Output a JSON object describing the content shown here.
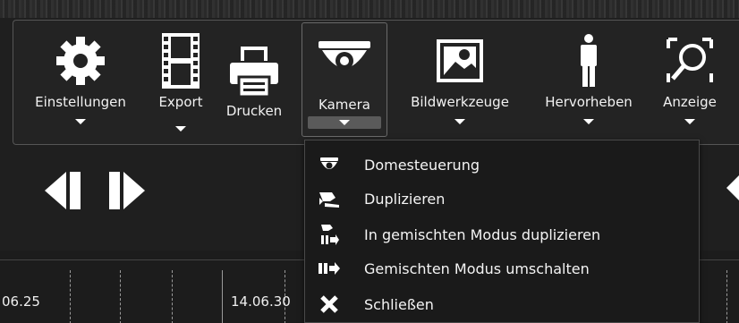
{
  "toolbar": {
    "tools": [
      {
        "label": "Einstellungen",
        "icon": "gear-icon",
        "has_dropdown": true
      },
      {
        "label": "Export",
        "icon": "film-strip-icon",
        "has_dropdown": true
      },
      {
        "label": "Drucken",
        "icon": "printer-icon",
        "has_dropdown": false
      },
      {
        "label": "Kamera",
        "icon": "dome-camera-icon",
        "has_dropdown": true,
        "active": true
      },
      {
        "label": "Bildwerkzeuge",
        "icon": "image-tools-icon",
        "has_dropdown": true
      },
      {
        "label": "Hervorheben",
        "icon": "person-icon",
        "has_dropdown": true
      },
      {
        "label": "Anzeige",
        "icon": "magnifier-icon",
        "has_dropdown": true
      }
    ]
  },
  "camera_menu": {
    "items": [
      {
        "label": "Domesteuerung",
        "icon": "dome-camera-icon"
      },
      {
        "label": "Duplizieren",
        "icon": "duplicate-camera-icon"
      },
      {
        "label": "In gemischten Modus duplizieren",
        "icon": "duplicate-mixed-mode-icon"
      },
      {
        "label": "Gemischten Modus umschalten",
        "icon": "mixed-mode-toggle-icon"
      },
      {
        "label": "Schließen",
        "icon": "close-icon"
      }
    ]
  },
  "timeline": {
    "labels": [
      "06.25",
      "14.06.30"
    ]
  },
  "colors": {
    "background": "#1f1f1f",
    "toolbar_bg": "#232323",
    "menu_bg": "#1a1a1a",
    "text": "#ffffff"
  }
}
